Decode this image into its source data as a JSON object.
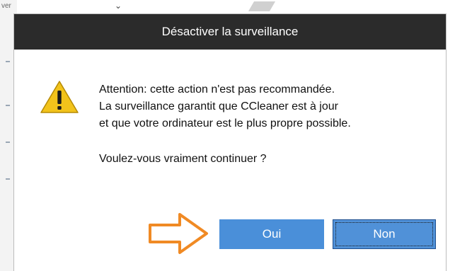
{
  "background_window": {
    "label": "ver",
    "chevron_icon": "chevron-down-icon"
  },
  "dialog": {
    "title": "Désactiver la surveillance",
    "icon": "warning-icon",
    "message_lines": [
      "Attention: cette action n'est pas recommandée.",
      "La surveillance garantit que CCleaner est à jour",
      "et que votre ordinateur est le plus propre possible."
    ],
    "question": "Voulez-vous vraiment continuer ?",
    "buttons": {
      "yes": "Oui",
      "no": "Non"
    }
  },
  "annotation": {
    "icon": "arrow-right-icon",
    "color": "#f08a24"
  },
  "colors": {
    "titlebar": "#2b2b2b",
    "button": "#4a8fd9",
    "warning": "#f2c31b"
  }
}
